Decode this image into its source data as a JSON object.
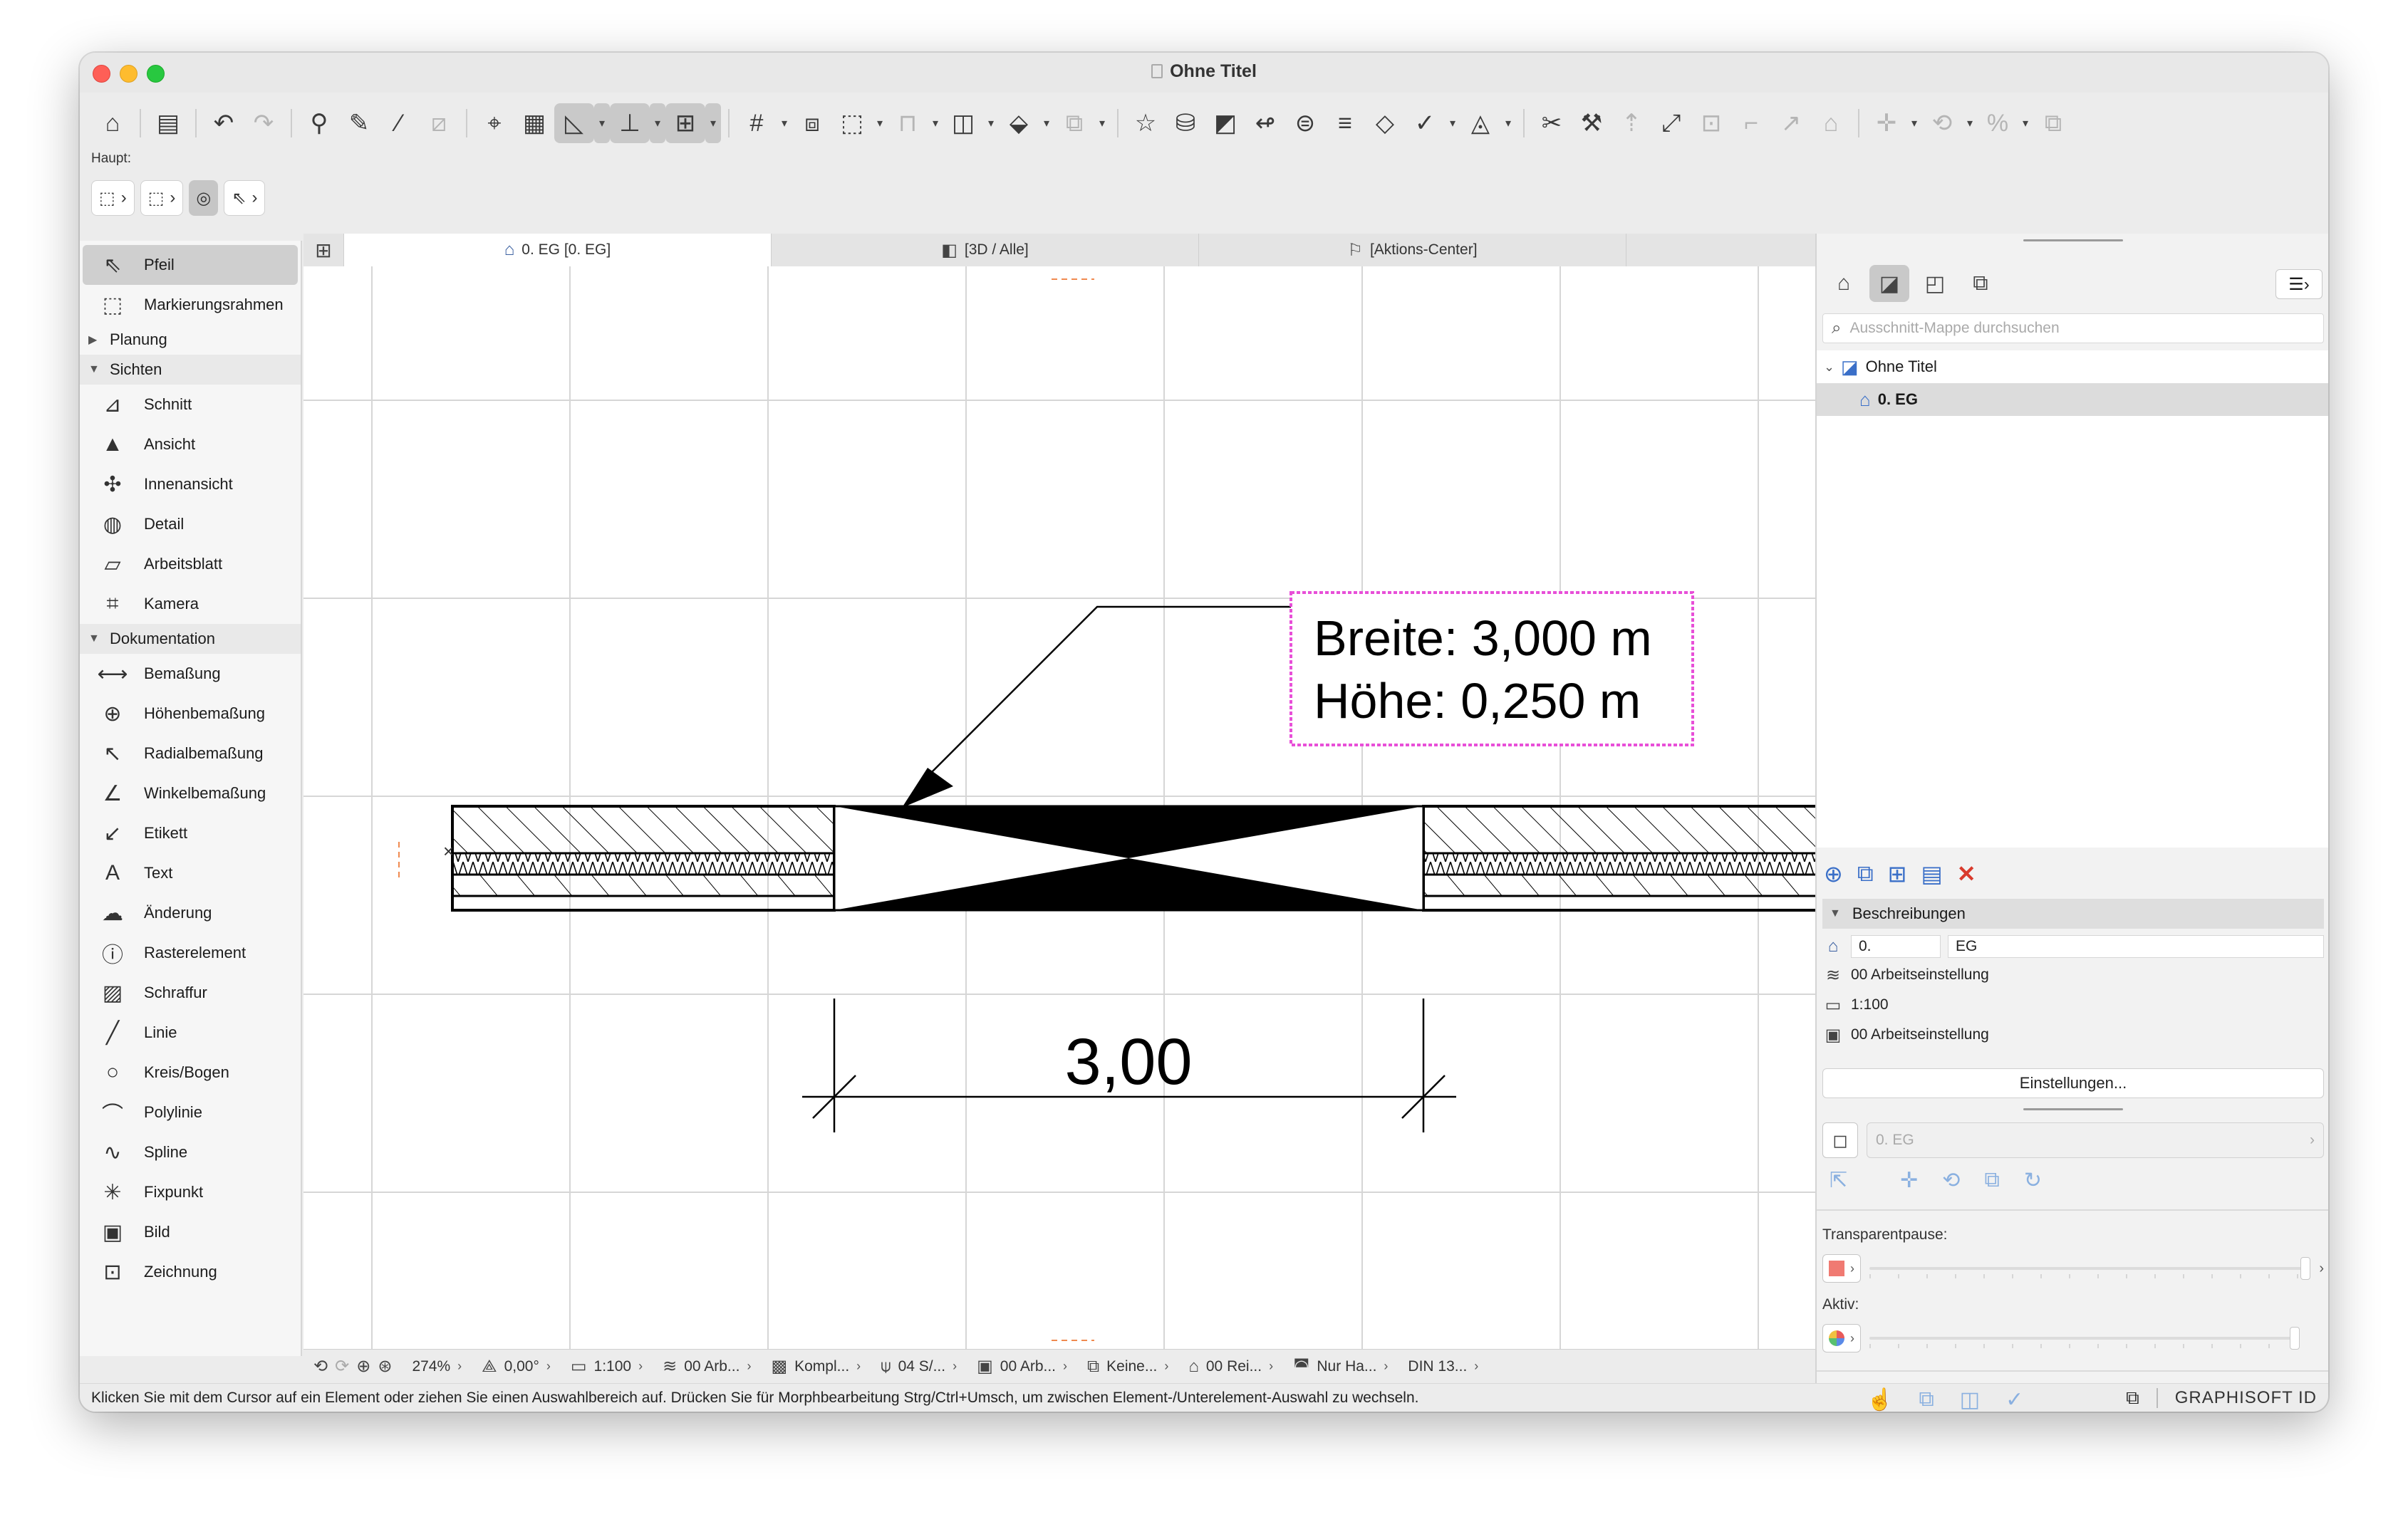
{
  "window": {
    "title": "Ohne Titel",
    "accent": "#3a6fc8",
    "highlight_color": "#e84fd8"
  },
  "toolbar": {
    "icons": [
      "home-icon",
      "save-icon",
      "undo-icon",
      "redo-icon",
      "pick-up-parameters-icon",
      "inject-parameters-icon",
      "magic-wand-icon",
      "trace-icon",
      "snap-guides-icon",
      "grid-icon",
      "guide-lines-icon",
      "gravity-icon",
      "grid-snap-icon",
      "edit-plane-icon",
      "select-icon",
      "lock-icon",
      "group-icon",
      "layer-combination-icon",
      "favorites-icon",
      "renovation-icon",
      "publish-icon",
      "teamwork-icon",
      "cloud-icon",
      "schedule-icon",
      "tag-icon",
      "check-icon",
      "shape-icon",
      "split-icon",
      "trim-icon",
      "elevate-icon",
      "resize-icon",
      "offset-icon",
      "fillet-icon",
      "roof-icon",
      "move-icon",
      "rotate-icon",
      "mirror-icon",
      "copy-icon"
    ]
  },
  "info_box": {
    "title": "Haupt:",
    "buttons": [
      "rubberband-geometry-icon",
      "marquee-icon",
      "gravity-toggle-icon",
      "arrow-select-icon"
    ]
  },
  "toolbox": {
    "top_tools": [
      {
        "label": "Pfeil",
        "icon": "arrow-icon",
        "glyph": "⇖",
        "selected": true
      },
      {
        "label": "Markierungsrahmen",
        "icon": "marquee-icon",
        "glyph": "⬚",
        "selected": false
      }
    ],
    "groups": [
      {
        "label": "Planung",
        "expanded": false,
        "tools": []
      },
      {
        "label": "Sichten",
        "expanded": true,
        "tools": [
          {
            "label": "Schnitt",
            "icon": "section-icon",
            "glyph": "⊿"
          },
          {
            "label": "Ansicht",
            "icon": "elevation-icon",
            "glyph": "▲"
          },
          {
            "label": "Innenansicht",
            "icon": "interior-elevation-icon",
            "glyph": "✣"
          },
          {
            "label": "Detail",
            "icon": "detail-icon",
            "glyph": "◍"
          },
          {
            "label": "Arbeitsblatt",
            "icon": "worksheet-icon",
            "glyph": "▱"
          },
          {
            "label": "Kamera",
            "icon": "camera-icon",
            "glyph": "⌗"
          }
        ]
      },
      {
        "label": "Dokumentation",
        "expanded": true,
        "tools": [
          {
            "label": "Bemaßung",
            "icon": "dimension-icon",
            "glyph": "⟷"
          },
          {
            "label": "Höhenbemaßung",
            "icon": "level-dimension-icon",
            "glyph": "⊕"
          },
          {
            "label": "Radialbemaßung",
            "icon": "radial-dimension-icon",
            "glyph": "↖"
          },
          {
            "label": "Winkelbemaßung",
            "icon": "angle-dimension-icon",
            "glyph": "∠"
          },
          {
            "label": "Etikett",
            "icon": "label-icon",
            "glyph": "↙"
          },
          {
            "label": "Text",
            "icon": "text-icon",
            "glyph": "A"
          },
          {
            "label": "Änderung",
            "icon": "revision-cloud-icon",
            "glyph": "☁"
          },
          {
            "label": "Rasterelement",
            "icon": "grid-element-icon",
            "glyph": "ⓘ"
          },
          {
            "label": "Schraffur",
            "icon": "fill-icon",
            "glyph": "▨"
          },
          {
            "label": "Linie",
            "icon": "line-icon",
            "glyph": "╱"
          },
          {
            "label": "Kreis/Bogen",
            "icon": "circle-icon",
            "glyph": "○"
          },
          {
            "label": "Polylinie",
            "icon": "polyline-icon",
            "glyph": "⌒"
          },
          {
            "label": "Spline",
            "icon": "spline-icon",
            "glyph": "∿"
          },
          {
            "label": "Fixpunkt",
            "icon": "hotspot-icon",
            "glyph": "✳"
          },
          {
            "label": "Bild",
            "icon": "picture-icon",
            "glyph": "▣"
          },
          {
            "label": "Zeichnung",
            "icon": "drawing-icon",
            "glyph": "⊡"
          }
        ]
      }
    ]
  },
  "tabs": [
    {
      "label": "0. EG [0. EG]",
      "icon": "floor-plan-icon",
      "active": true
    },
    {
      "label": "[3D / Alle]",
      "icon": "3d-window-icon",
      "active": false
    },
    {
      "label": "[Aktions-Center]",
      "icon": "action-center-icon",
      "active": false
    }
  ],
  "drawing": {
    "label_line1": "Breite: 3,000 m",
    "label_line2": "Höhe: 0,250 m",
    "dimension_text": "3,00"
  },
  "bottom_bar": [
    {
      "icon": "zoom-in-icon",
      "value": "274%"
    },
    {
      "icon": "orientation-icon",
      "value": "0,00°"
    },
    {
      "icon": "scale-icon",
      "value": "1:100"
    },
    {
      "icon": "layer-combination-icon",
      "value": "00 Arb..."
    },
    {
      "icon": "structure-display-icon",
      "value": "Kompl..."
    },
    {
      "icon": "pen-set-icon",
      "value": "04 S/..."
    },
    {
      "icon": "model-view-icon",
      "value": "00 Arb..."
    },
    {
      "icon": "override-icon",
      "value": "Keine..."
    },
    {
      "icon": "renovation-filter-icon",
      "value": "00 Rei..."
    },
    {
      "icon": "design-options-icon",
      "value": "Nur Ha..."
    },
    {
      "icon": "dimension-standard-icon",
      "value": "DIN 13..."
    }
  ],
  "status": {
    "message": "Klicken Sie mit dem Cursor auf ein Element oder ziehen Sie einen Auswahlbereich auf. Drücken Sie für Morphbearbeitung Strg/Ctrl+Umsch, um zwischen Element-/Unterelement-Auswahl zu wechseln.",
    "brand": "GRAPHISOFT ID"
  },
  "navigator": {
    "search_placeholder": "Ausschnitt-Mappe durchsuchen",
    "tree": [
      {
        "label": "Ohne Titel",
        "level": 0,
        "selected": false
      },
      {
        "label": "0. EG",
        "level": 1,
        "selected": true
      }
    ],
    "section_title": "Beschreibungen",
    "id_value": "0.",
    "name_value": "EG",
    "layer_combination": "00 Arbeitseinstellung",
    "scale": "1:100",
    "model_view": "00 Arbeitseinstellung",
    "settings_button": "Einstellungen...",
    "view_field": "0. EG",
    "transparent_label": "Transparentpause:",
    "active_label": "Aktiv:"
  }
}
